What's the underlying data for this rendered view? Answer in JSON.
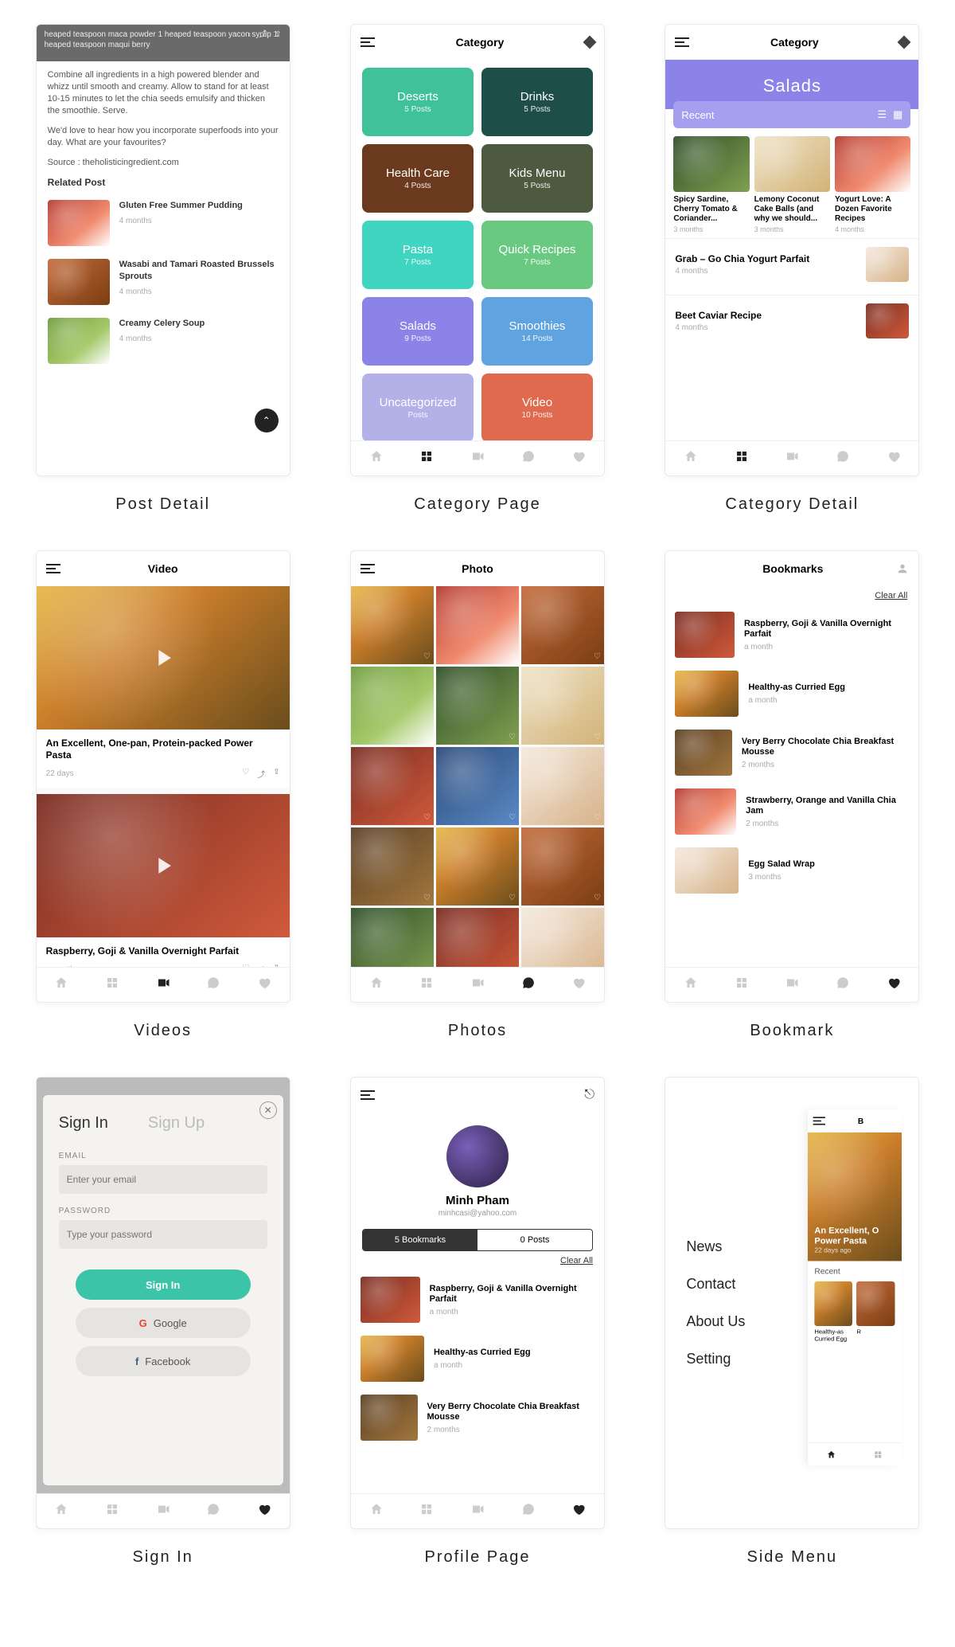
{
  "captions": {
    "c1": "Post Detail",
    "c2": "Category Page",
    "c3": "Category Detail",
    "c4": "Videos",
    "c5": "Photos",
    "c6": "Bookmark",
    "c7": "Sign In",
    "c8": "Profile Page",
    "c9": "Side Menu"
  },
  "topbar": {
    "category": "Category",
    "video": "Video",
    "photo": "Photo",
    "bookmarks": "Bookmarks"
  },
  "postDetail": {
    "heroLine": "heaped teaspoon maca powder 1 heaped teaspoon yacon syrup 1 heaped teaspoon maqui berry",
    "p1": "Combine all ingredients in a high powered blender and whizz until smooth and creamy. Allow to stand for at least 10-15 minutes to let the chia seeds emulsify and thicken the smoothie. Serve.",
    "p2": "We'd love to hear how you incorporate superfoods into your day. What are your favourites?",
    "source": "Source : theholisticingredient.com",
    "relatedTitle": "Related Post",
    "items": [
      {
        "t": "Gluten Free Summer Pudding",
        "d": "4 months"
      },
      {
        "t": "Wasabi and Tamari Roasted Brussels Sprouts",
        "d": "4 months"
      },
      {
        "t": "Creamy Celery Soup",
        "d": "4 months"
      }
    ]
  },
  "categories": [
    {
      "n": "Deserts",
      "p": "5 Posts",
      "c": "#3fc19a"
    },
    {
      "n": "Drinks",
      "p": "5 Posts",
      "c": "#1e4e49"
    },
    {
      "n": "Health Care",
      "p": "4 Posts",
      "c": "#6b3a1e"
    },
    {
      "n": "Kids Menu",
      "p": "5 Posts",
      "c": "#4e5a3f"
    },
    {
      "n": "Pasta",
      "p": "7 Posts",
      "c": "#3fd5c0"
    },
    {
      "n": "Quick Recipes",
      "p": "7 Posts",
      "c": "#6ac981"
    },
    {
      "n": "Salads",
      "p": "9 Posts",
      "c": "#8b83e8"
    },
    {
      "n": "Smoothies",
      "p": "14 Posts",
      "c": "#5fa3e0"
    },
    {
      "n": "Uncategorized",
      "p": "Posts",
      "c": "#b4b0e8"
    },
    {
      "n": "Video",
      "p": "10 Posts",
      "c": "#e06a4e"
    }
  ],
  "catDetail": {
    "title": "Salads",
    "filter": "Recent",
    "cards": [
      {
        "t": "Spicy Sardine, Cherry Tomato & Coriander...",
        "d": "3 months"
      },
      {
        "t": "Lemony Coconut Cake Balls (and why we should...",
        "d": "3 months"
      },
      {
        "t": "Yogurt Love: A Dozen Favorite Recipes",
        "d": "4 months"
      }
    ],
    "rows": [
      {
        "t": "Grab – Go Chia Yogurt Parfait",
        "d": "4 months"
      },
      {
        "t": "Beet Caviar Recipe",
        "d": "4 months"
      }
    ]
  },
  "videos": [
    {
      "t": "An Excellent, One-pan, Protein-packed Power Pasta",
      "d": "22 days"
    },
    {
      "t": "Raspberry, Goji & Vanilla Overnight Parfait",
      "d": "a month"
    }
  ],
  "bookmarks": {
    "clear": "Clear All",
    "items": [
      {
        "t": "Raspberry, Goji & Vanilla Overnight Parfait",
        "d": "a month"
      },
      {
        "t": "Healthy-as Curried Egg",
        "d": "a month"
      },
      {
        "t": "Very Berry Chocolate Chia Breakfast Mousse",
        "d": "2 months"
      },
      {
        "t": "Strawberry, Orange and Vanilla Chia Jam",
        "d": "2 months"
      },
      {
        "t": "Egg Salad Wrap",
        "d": "3 months"
      }
    ]
  },
  "signin": {
    "tabIn": "Sign In",
    "tabUp": "Sign Up",
    "emailLabel": "EMAIL",
    "emailPh": "Enter your email",
    "pwdLabel": "PASSWORD",
    "pwdPh": "Type your password",
    "primary": "Sign In",
    "google": "Google",
    "facebook": "Facebook"
  },
  "profile": {
    "name": "Minh Pham",
    "mail": "minhcasi@yahoo.com",
    "seg1": "5 Bookmarks",
    "seg2": "0 Posts",
    "clear": "Clear All",
    "items": [
      {
        "t": "Raspberry, Goji & Vanilla Overnight Parfait",
        "d": "a month"
      },
      {
        "t": "Healthy-as Curried Egg",
        "d": "a month"
      },
      {
        "t": "Very Berry Chocolate Chia Breakfast Mousse",
        "d": "2 months"
      }
    ]
  },
  "sideMenu": {
    "items": [
      "News",
      "Contact",
      "About Us",
      "Setting"
    ],
    "previewTitle": "An Excellent, O\nPower Pasta",
    "previewDate": "22 days ago",
    "filter": "Recent",
    "cards": [
      {
        "t": "Healthy-as Curried Egg"
      },
      {
        "t": "R"
      }
    ],
    "topTitle": "B"
  }
}
